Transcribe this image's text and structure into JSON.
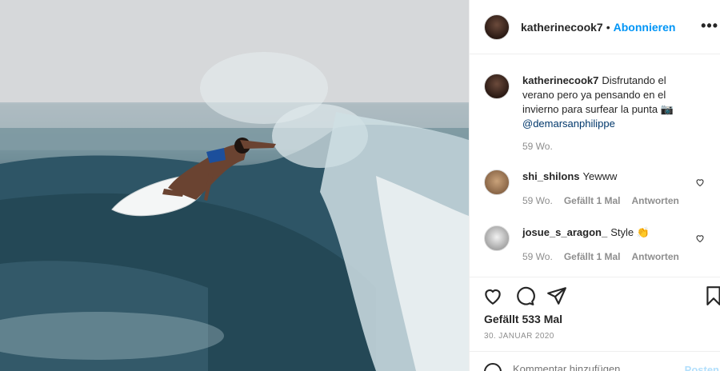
{
  "post": {
    "author": "katherinecook7",
    "separator": "•",
    "follow_label": "Abonnieren",
    "more_label": "•••"
  },
  "caption": {
    "username": "katherinecook7",
    "text": "Disfrutando el verano pero ya pensando en el invierno para surfear la punta 📷",
    "mention": "@demarsanphilippe",
    "time": "59 Wo."
  },
  "comments": [
    {
      "username": "shi_shilons",
      "text": "Yewww",
      "time": "59 Wo.",
      "likes": "Gefällt 1 Mal",
      "reply": "Antworten"
    },
    {
      "username": "josue_s_aragon_",
      "text": "Style 👏",
      "time": "59 Wo.",
      "likes": "Gefällt 1 Mal",
      "reply": "Antworten"
    }
  ],
  "actions": {
    "likes_count": "Gefällt 533 Mal",
    "date": "30. JANUAR 2020"
  },
  "add_comment": {
    "placeholder": "Kommentar hinzufügen ...",
    "post_label": "Posten"
  },
  "icons": {
    "like": "heart-icon",
    "comment": "comment-icon",
    "share": "paper-plane-icon",
    "save": "bookmark-icon",
    "emoji": "smiley-icon"
  },
  "colors": {
    "link_blue": "#0095f6",
    "muted": "#8e8e8e",
    "text": "#262626"
  }
}
